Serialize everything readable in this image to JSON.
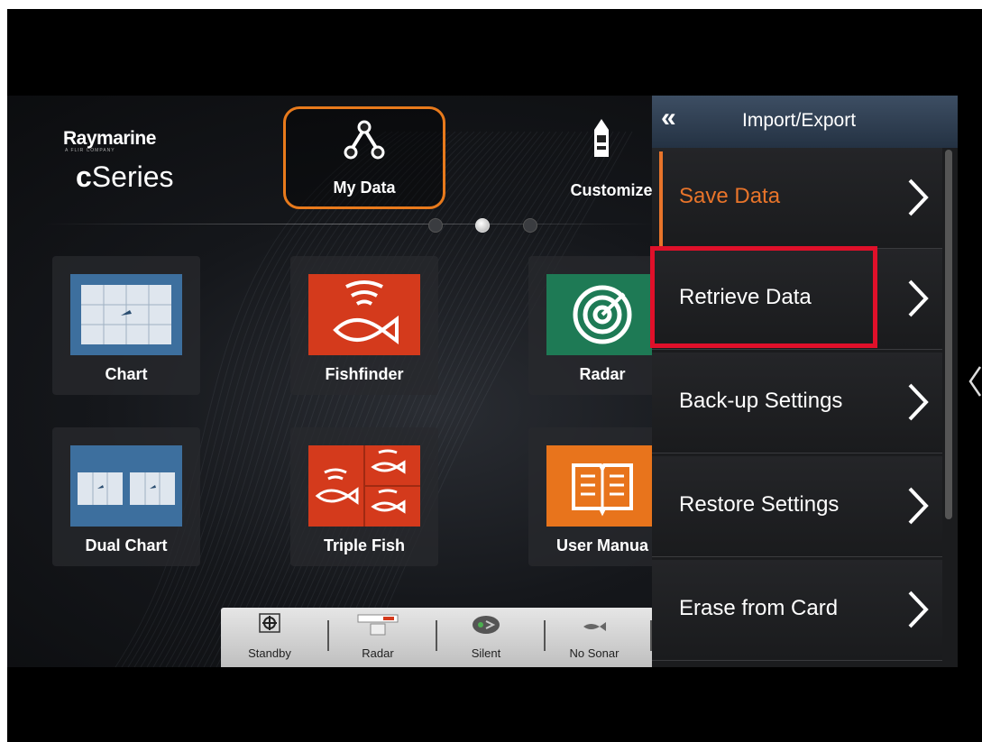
{
  "brand": {
    "name": "Raymarine",
    "tagline": "A FLIR COMPANY",
    "series_prefix": "c",
    "series": "Series"
  },
  "top_tiles": [
    {
      "label": "My Data",
      "icon": "waypoint-route-icon"
    },
    {
      "label": "Customize",
      "icon": "boat-icon"
    }
  ],
  "page_dots": {
    "count": 3,
    "active": 2
  },
  "apps": [
    {
      "label": "Chart",
      "icon": "chart-icon"
    },
    {
      "label": "Fishfinder",
      "icon": "fishfinder-icon"
    },
    {
      "label": "Radar",
      "icon": "radar-icon"
    },
    {
      "label": "Dual Chart",
      "icon": "dual-chart-icon"
    },
    {
      "label": "Triple Fish",
      "icon": "triple-fish-icon"
    },
    {
      "label": "User Manua",
      "icon": "user-manual-icon"
    }
  ],
  "status_bar": [
    {
      "label": "Standby",
      "icon": "autopilot-icon"
    },
    {
      "label": "Radar",
      "icon": "radar-scanner-icon"
    },
    {
      "label": "Silent",
      "icon": "ais-silent-icon"
    },
    {
      "label": "No Sonar",
      "icon": "sonar-fish-icon"
    }
  ],
  "panel": {
    "title": "Import/Export",
    "back_icon": "double-chevron-left-icon",
    "items": [
      {
        "label": "Save Data",
        "selected": true
      },
      {
        "label": "Retrieve Data",
        "selected": false
      },
      {
        "label": "Back-up Settings",
        "selected": false
      },
      {
        "label": "Restore Settings",
        "selected": false
      },
      {
        "label": "Erase from Card",
        "selected": false
      }
    ]
  },
  "colors": {
    "accent": "#e8742a",
    "highlight": "#e0102a",
    "header": "#2e3d50"
  }
}
